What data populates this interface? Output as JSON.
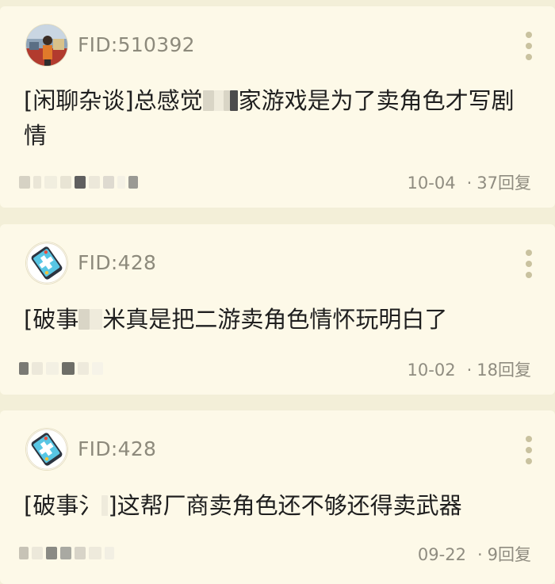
{
  "posts": [
    {
      "fid": "FID:510392",
      "title_before": "[闲聊杂谈]总感觉",
      "title_after": "家游戏是为了卖角色才写剧情",
      "date": "10-04",
      "dot": "·",
      "replies": "37回复",
      "avatar_icon": "photo-avatar-icon"
    },
    {
      "fid": "FID:428",
      "title_before": "[破事",
      "title_after": "米真是把二游卖角色情怀玩明白了",
      "date": "10-02",
      "dot": "·",
      "replies": "18回复",
      "avatar_icon": "gamepad-phone-avatar-icon"
    },
    {
      "fid": "FID:428",
      "title_before": "[破事氵",
      "title_after": "]这帮厂商卖角色还不够还得卖武器",
      "date": "09-22",
      "dot": "·",
      "replies": "9回复",
      "avatar_icon": "gamepad-phone-avatar-icon"
    }
  ],
  "colors": {
    "background": "#f3efd8",
    "card": "#fdf9e8",
    "text": "#1f1f1f",
    "muted": "#8f8c80",
    "menu_dots": "#c9c29f"
  }
}
